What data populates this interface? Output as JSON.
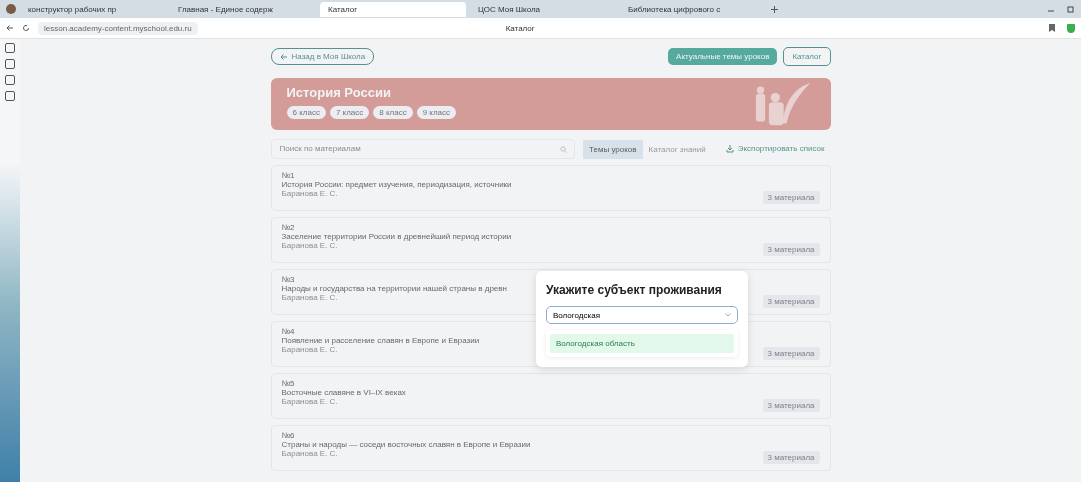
{
  "browser": {
    "tabs": [
      {
        "label": "конструктор рабочих пр",
        "selected": false
      },
      {
        "label": "Главная - Единое содерж",
        "selected": false
      },
      {
        "label": "Каталог",
        "selected": true
      },
      {
        "label": "ЦОС Моя Школа",
        "selected": false
      },
      {
        "label": "Библиотека цифрового с",
        "selected": false
      }
    ],
    "url": "lesson.academy-content.myschool.edu.ru",
    "page_title": "Каталог"
  },
  "page": {
    "back_button": "Назад в Моя Школа",
    "actions": [
      {
        "label": "Актуальные темы уроков",
        "kind": "primary"
      },
      {
        "label": "Каталог",
        "kind": "secondary"
      }
    ],
    "banner": {
      "title": "История России",
      "grades": [
        "6 класс",
        "7 класс",
        "8 класс",
        "9 класс"
      ]
    },
    "search": {
      "placeholder": "Поиск по материалам"
    },
    "view_tabs": [
      {
        "label": "Темы уроков",
        "selected": true
      },
      {
        "label": "Каталог знаний",
        "selected": false
      }
    ],
    "export_button": "Экспортировать список",
    "lessons": [
      {
        "number": "№1",
        "title": "История России: предмет изучения, периодизация, источники",
        "author": "Баранова Е. С.",
        "badge": "3 материала"
      },
      {
        "number": "№2",
        "title": "Заселение территории России в древнейший период истории",
        "author": "Баранова Е. С.",
        "badge": "3 материала"
      },
      {
        "number": "№3",
        "title": "Народы и государства на территории нашей страны в древн",
        "author": "Баранова Е. С.",
        "badge": "3 материала"
      },
      {
        "number": "№4",
        "title": "Появление и расселение славян в Европе и Евразии",
        "author": "Баранова Е. С.",
        "badge": "3 материала"
      },
      {
        "number": "№5",
        "title": "Восточные славяне в VI–IX веках",
        "author": "Баранова Е. С.",
        "badge": "3 материала"
      },
      {
        "number": "№6",
        "title": "Страны и народы — соседи восточных славян в Европе и Евразии",
        "author": "Баранова Е. С.",
        "badge": "3 материала"
      }
    ]
  },
  "modal": {
    "title": "Укажите субъект проживания",
    "input_value": "Вологодская",
    "options": [
      {
        "label": "Вологодская область",
        "selected": true
      }
    ]
  }
}
